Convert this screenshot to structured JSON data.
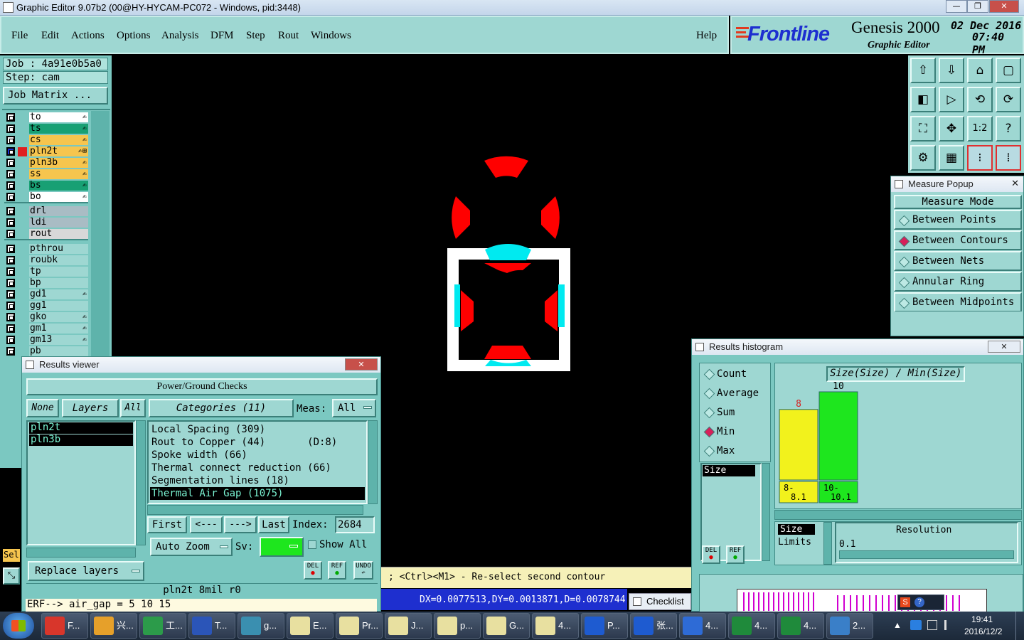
{
  "window": {
    "title": "Graphic Editor 9.07b2 (00@HY-HYCAM-PC072 - Windows, pid:3448)",
    "min": "—",
    "max": "❐",
    "close": "✕"
  },
  "menu": {
    "items": [
      "File",
      "Edit",
      "Actions",
      "Options",
      "Analysis",
      "DFM",
      "Step",
      "Rout",
      "Windows"
    ],
    "help": "Help"
  },
  "logo": {
    "brand": "Frontline",
    "product": "Genesis 2000",
    "subtitle": "Graphic Editor",
    "date": "02 Dec 2016",
    "time": "07:40 PM"
  },
  "job": {
    "job_label": "Job : 4a91e0b5a0",
    "step_label": "Step: cam",
    "matrix_button": "Job Matrix ..."
  },
  "layers": [
    {
      "name": "to",
      "color": "#ffffff",
      "mark": "✍"
    },
    {
      "name": "ts",
      "color": "#18a074",
      "mark": "✍"
    },
    {
      "name": "cs",
      "color": "#f6c54e",
      "mark": "✍"
    },
    {
      "name": "pln2t",
      "color": "#f6c54e",
      "mark": "✍⊞",
      "active": true
    },
    {
      "name": "pln3b",
      "color": "#f6c54e",
      "mark": "✍"
    },
    {
      "name": "ss",
      "color": "#f6c54e",
      "mark": "✍"
    },
    {
      "name": "bs",
      "color": "#18a074",
      "mark": "✍"
    },
    {
      "name": "bo",
      "color": "#ffffff",
      "mark": "✍"
    },
    {
      "name": "drl",
      "color": "#a9bcc4",
      "mark": ""
    },
    {
      "name": "ldi",
      "color": "#a9bcc4",
      "mark": ""
    },
    {
      "name": "rout",
      "color": "#d8d8d8",
      "mark": ""
    },
    {
      "name": "pthrou",
      "color": "#9ed7d2",
      "mark": ""
    },
    {
      "name": "roubk",
      "color": "#9ed7d2",
      "mark": ""
    },
    {
      "name": "tp",
      "color": "#9ed7d2",
      "mark": ""
    },
    {
      "name": "bp",
      "color": "#9ed7d2",
      "mark": ""
    },
    {
      "name": "gd1",
      "color": "#9ed7d2",
      "mark": "✍"
    },
    {
      "name": "gg1",
      "color": "#9ed7d2",
      "mark": ""
    },
    {
      "name": "gko",
      "color": "#9ed7d2",
      "mark": "✍"
    },
    {
      "name": "gm1",
      "color": "#9ed7d2",
      "mark": "✍"
    },
    {
      "name": "gm13",
      "color": "#9ed7d2",
      "mark": "✍"
    },
    {
      "name": "pb",
      "color": "#9ed7d2",
      "mark": ""
    }
  ],
  "toolbar_icons": [
    "open-step-icon",
    "save-icon",
    "home-icon",
    "window-icon",
    "pan-left-icon",
    "pan-right-icon",
    "undo-icon",
    "redo-icon",
    "zoom-fit-icon",
    "zoom-center-icon",
    "scale-icon",
    "help-icon",
    "settings-icon",
    "grid-icon",
    "snap-red-icon",
    "snap-blue-icon"
  ],
  "toolbar_glyphs": [
    "⇧",
    "⇩",
    "⌂",
    "▢",
    "◧",
    "▷",
    "⟲",
    "⟳",
    "⛶",
    "✥",
    "1:2",
    "?",
    "⚙",
    "▦",
    "⁝",
    "⁞"
  ],
  "measure": {
    "title": "Measure Popup",
    "mode_label": "Measure Mode",
    "options": [
      "Between Points",
      "Between Contours",
      "Between Nets",
      "Annular Ring",
      "Between Midpoints"
    ],
    "selected": 1,
    "close_label": "Close"
  },
  "results_viewer": {
    "title": "Results viewer",
    "header": "Power/Ground Checks",
    "none": "None",
    "layers": "Layers",
    "all": "All",
    "categories": "Categories (11)",
    "meas_label": "Meas:",
    "meas_value": "All",
    "layer_list": [
      "pln2t",
      "pln3b"
    ],
    "category_list": [
      "Local Spacing (309)",
      "Rout to Copper (44)       (D:8)",
      "Spoke width (66)",
      "Thermal connect reduction (66)",
      "Segmentation lines (18)",
      "Thermal Air Gap (1075)"
    ],
    "selected_category": 5,
    "first": "First",
    "prev": "<---",
    "next": "--->",
    "last": "Last",
    "index_label": "Index:",
    "index_value": "2684",
    "auto_zoom": "Auto Zoom",
    "sv_label": "Sv:",
    "show_all": "Show All",
    "replace_layers": "Replace layers",
    "del": "DEL",
    "ref": "REF",
    "undo": "UNDO",
    "footer": "pln2t 8mil  r0"
  },
  "histogram": {
    "title": "Results histogram",
    "stats": [
      "Count",
      "Average",
      "Sum",
      "Min",
      "Max"
    ],
    "selected_stat": 3,
    "field": "Size",
    "chart_title": "Size(Size) / Min(Size)",
    "size_label": "Size",
    "limits_label": "Limits",
    "resolution_label": "Resolution",
    "resolution_value": "0.1",
    "del": "DEL",
    "ref": "REF"
  },
  "chart_data": {
    "type": "bar",
    "title": "Size(Size) / Min(Size)",
    "categories": [
      "8-8.1",
      "10-10.1"
    ],
    "category_lines": [
      [
        "8-",
        "8.1"
      ],
      [
        "10-",
        "10.1"
      ]
    ],
    "values": [
      8,
      10
    ],
    "colors": [
      "#f2f21c",
      "#1ee61e"
    ],
    "label_colors": [
      "#d71f1f",
      "#000000"
    ],
    "ylim": [
      0,
      10
    ]
  },
  "status": {
    "prompt": "; <Ctrl><M1> - Re-select second contour",
    "measurement": "DX=0.0077513,DY=0.0013871,D=0.0078744",
    "erf": "ERF--> air_gap = 5 10 15",
    "checklist": "Checklist E",
    "sel": "Sel"
  },
  "taskbar": {
    "items": [
      {
        "label": "F...",
        "color": "#d8362b"
      },
      {
        "label": "兴...",
        "color": "#e6a02a"
      },
      {
        "label": "工...",
        "color": "#2c9b4a"
      },
      {
        "label": "T...",
        "color": "#2b55b8"
      },
      {
        "label": "g...",
        "color": "#3a8fb0"
      },
      {
        "label": "E...",
        "color": "#e8e0a0"
      },
      {
        "label": "Pr...",
        "color": "#e8e0a0"
      },
      {
        "label": "J...",
        "color": "#e8e0a0"
      },
      {
        "label": "p...",
        "color": "#e8e0a0"
      },
      {
        "label": "G...",
        "color": "#e8e0a0"
      },
      {
        "label": "4...",
        "color": "#e8e0a0"
      },
      {
        "label": "P...",
        "color": "#1e5bd0"
      },
      {
        "label": "张...",
        "color": "#1e5bd0"
      },
      {
        "label": "4...",
        "color": "#2e6bd6"
      },
      {
        "label": "4...",
        "color": "#1f8a3b"
      },
      {
        "label": "4...",
        "color": "#1f8a3b"
      },
      {
        "label": "2...",
        "color": "#3a7fc8"
      }
    ],
    "clock_time": "19:41",
    "clock_date": "2016/12/2"
  }
}
